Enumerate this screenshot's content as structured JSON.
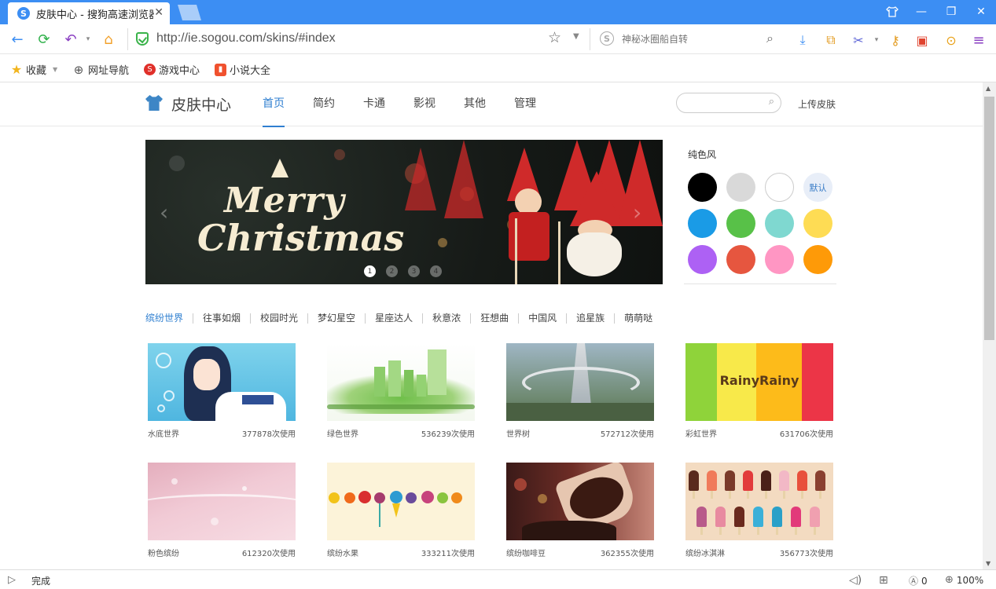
{
  "browser": {
    "tab_title": "皮肤中心 - 搜狗高速浏览器",
    "tab_favicon": "S",
    "url": "http://ie.sogou.com/skins/#index",
    "search_placeholder": "神秘冰圈船自转",
    "search_logo": "S",
    "accent": "#3c8ef3"
  },
  "bookmarks": [
    {
      "label": "收藏",
      "icon": "star-icon"
    },
    {
      "label": "网址导航",
      "icon": "globe-icon"
    },
    {
      "label": "游戏中心",
      "icon": "game-icon"
    },
    {
      "label": "小说大全",
      "icon": "book-icon"
    }
  ],
  "site": {
    "title": "皮肤中心",
    "nav": [
      "首页",
      "简约",
      "卡通",
      "影视",
      "其他",
      "管理"
    ],
    "active_nav": "首页",
    "upload_label": "上传皮肤",
    "banner": {
      "line1": "Merry",
      "line2": "Christmas",
      "pages": [
        "1",
        "2",
        "3",
        "4"
      ],
      "active_page": "1"
    },
    "colors_title": "纯色风",
    "swatches": [
      {
        "color": "#000000",
        "label": ""
      },
      {
        "color": "#d9d9d9",
        "label": ""
      },
      {
        "color": "#ffffff",
        "label": ""
      },
      {
        "color": "#e8eef8",
        "label": "默认"
      },
      {
        "color": "#1a9be6",
        "label": ""
      },
      {
        "color": "#58c148",
        "label": ""
      },
      {
        "color": "#7fd8d0",
        "label": ""
      },
      {
        "color": "#fedc54",
        "label": ""
      },
      {
        "color": "#ad61f4",
        "label": ""
      },
      {
        "color": "#e6563f",
        "label": ""
      },
      {
        "color": "#ff96c3",
        "label": ""
      },
      {
        "color": "#fe9a08",
        "label": ""
      }
    ],
    "categories": [
      "缤纷世界",
      "往事如烟",
      "校园时光",
      "梦幻星空",
      "星座达人",
      "秋意浓",
      "狂想曲",
      "中国风",
      "追星族",
      "萌萌哒"
    ],
    "active_category": "缤纷世界",
    "skins": [
      {
        "name": "水底世界",
        "uses": "377878次使用"
      },
      {
        "name": "绿色世界",
        "uses": "536239次使用"
      },
      {
        "name": "世界树",
        "uses": "572712次使用"
      },
      {
        "name": "彩虹世界",
        "uses": "631706次使用"
      },
      {
        "name": "粉色缤纷",
        "uses": "612320次使用"
      },
      {
        "name": "缤纷水果",
        "uses": "333211次使用"
      },
      {
        "name": "缤纷咖啡豆",
        "uses": "362355次使用"
      },
      {
        "name": "缤纷冰淇淋",
        "uses": "356773次使用"
      }
    ],
    "rainbow_text": "RainyRainy"
  },
  "status": {
    "text": "完成",
    "ad_count": "0",
    "zoom": "100%"
  }
}
